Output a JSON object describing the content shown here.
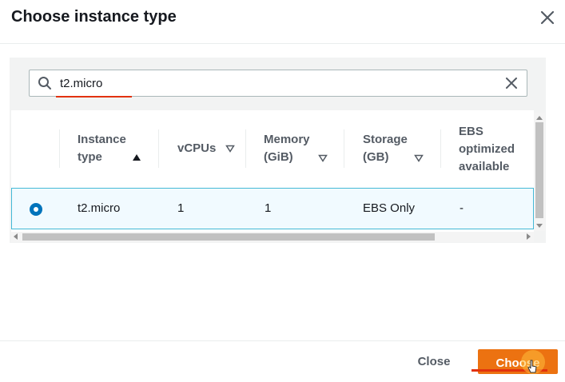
{
  "modal": {
    "title": "Choose instance type"
  },
  "search": {
    "value": "t2.micro"
  },
  "table": {
    "columns": [
      {
        "label": "Instance\ntype",
        "sort": "ascending"
      },
      {
        "label": "vCPUs",
        "sort": "none"
      },
      {
        "label": "Memory\n(GiB)",
        "sort": "none"
      },
      {
        "label": "Storage\n(GB)",
        "sort": "none"
      },
      {
        "label": "EBS\noptimized\navailable",
        "sort": "none"
      }
    ],
    "rows": [
      {
        "selected": true,
        "instance_type": "t2.micro",
        "vcpus": "1",
        "memory": "1",
        "storage": "EBS Only",
        "ebs_optimized": "-"
      }
    ]
  },
  "footer": {
    "close_label": "Close",
    "choose_label": "Choose"
  },
  "colors": {
    "primary_button": "#ec7211",
    "selected_row_border": "#44b9d6",
    "selected_row_bg": "#f1faff",
    "radio_selected": "#0073bb",
    "annotation_underline": "#e2320d"
  },
  "icons": {
    "close": "close-icon",
    "search": "search-icon",
    "clear": "clear-icon",
    "sort_ascending": "sort-ascending-icon",
    "sort_descending": "sort-caret-down-icon"
  }
}
